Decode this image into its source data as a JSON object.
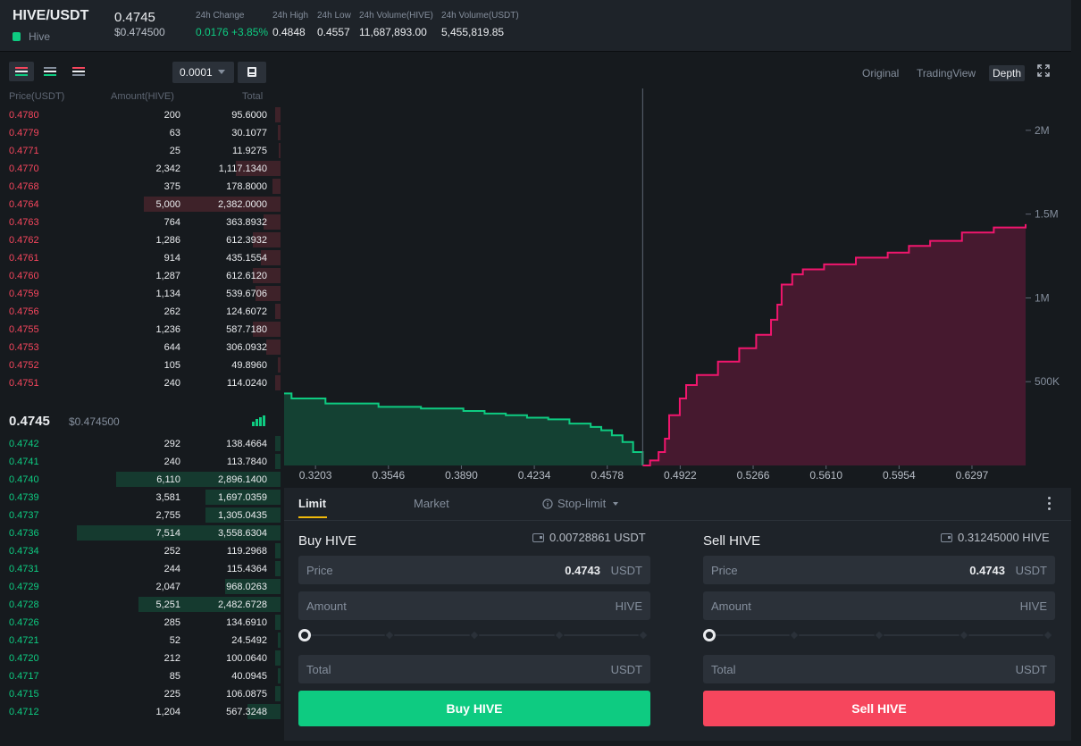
{
  "header": {
    "pair": "HIVE/USDT",
    "coin_name": "Hive",
    "last_price": "0.4745",
    "last_price_usd": "$0.474500",
    "stats": [
      {
        "label": "24h Change",
        "value": "0.0176 +3.85%"
      },
      {
        "label": "24h High",
        "value": "0.4848"
      },
      {
        "label": "24h Low",
        "value": "0.4557"
      },
      {
        "label": "24h Volume(HIVE)",
        "value": "11,687,893.00"
      },
      {
        "label": "24h Volume(USDT)",
        "value": "5,455,819.85"
      }
    ]
  },
  "orderbook": {
    "tick_size": "0.0001",
    "columns": [
      "Price(USDT)",
      "Amount(HIVE)",
      "Total"
    ],
    "asks": [
      {
        "price": "0.4780",
        "amount": "200",
        "total": "95.6000",
        "depth": 0.02
      },
      {
        "price": "0.4779",
        "amount": "63",
        "total": "30.1077",
        "depth": 0.01
      },
      {
        "price": "0.4771",
        "amount": "25",
        "total": "11.9275",
        "depth": 0.005
      },
      {
        "price": "0.4770",
        "amount": "2,342",
        "total": "1,117.1340",
        "depth": 0.16
      },
      {
        "price": "0.4768",
        "amount": "375",
        "total": "178.8000",
        "depth": 0.03
      },
      {
        "price": "0.4764",
        "amount": "5,000",
        "total": "2,382.0000",
        "depth": 0.49
      },
      {
        "price": "0.4763",
        "amount": "764",
        "total": "363.8932",
        "depth": 0.06
      },
      {
        "price": "0.4762",
        "amount": "1,286",
        "total": "612.3932",
        "depth": 0.1
      },
      {
        "price": "0.4761",
        "amount": "914",
        "total": "435.1554",
        "depth": 0.07
      },
      {
        "price": "0.4760",
        "amount": "1,287",
        "total": "612.6120",
        "depth": 0.1
      },
      {
        "price": "0.4759",
        "amount": "1,134",
        "total": "539.6706",
        "depth": 0.09
      },
      {
        "price": "0.4756",
        "amount": "262",
        "total": "124.6072",
        "depth": 0.02
      },
      {
        "price": "0.4755",
        "amount": "1,236",
        "total": "587.7180",
        "depth": 0.1
      },
      {
        "price": "0.4753",
        "amount": "644",
        "total": "306.0932",
        "depth": 0.05
      },
      {
        "price": "0.4752",
        "amount": "105",
        "total": "49.8960",
        "depth": 0.01
      },
      {
        "price": "0.4751",
        "amount": "240",
        "total": "114.0240",
        "depth": 0.02
      }
    ],
    "mid_price": "0.4745",
    "mid_price_usd": "$0.474500",
    "bids": [
      {
        "price": "0.4742",
        "amount": "292",
        "total": "138.4664",
        "depth": 0.02
      },
      {
        "price": "0.4741",
        "amount": "240",
        "total": "113.7840",
        "depth": 0.02
      },
      {
        "price": "0.4740",
        "amount": "6,110",
        "total": "2,896.1400",
        "depth": 0.59
      },
      {
        "price": "0.4739",
        "amount": "3,581",
        "total": "1,697.0359",
        "depth": 0.27
      },
      {
        "price": "0.4737",
        "amount": "2,755",
        "total": "1,305.0435",
        "depth": 0.27
      },
      {
        "price": "0.4736",
        "amount": "7,514",
        "total": "3,558.6304",
        "depth": 0.73
      },
      {
        "price": "0.4734",
        "amount": "252",
        "total": "119.2968",
        "depth": 0.02
      },
      {
        "price": "0.4731",
        "amount": "244",
        "total": "115.4364",
        "depth": 0.02
      },
      {
        "price": "0.4729",
        "amount": "2,047",
        "total": "968.0263",
        "depth": 0.2
      },
      {
        "price": "0.4728",
        "amount": "5,251",
        "total": "2,482.6728",
        "depth": 0.51
      },
      {
        "price": "0.4726",
        "amount": "285",
        "total": "134.6910",
        "depth": 0.02
      },
      {
        "price": "0.4721",
        "amount": "52",
        "total": "24.5492",
        "depth": 0.01
      },
      {
        "price": "0.4720",
        "amount": "212",
        "total": "100.0640",
        "depth": 0.02
      },
      {
        "price": "0.4717",
        "amount": "85",
        "total": "40.0945",
        "depth": 0.01
      },
      {
        "price": "0.4715",
        "amount": "225",
        "total": "106.0875",
        "depth": 0.02
      },
      {
        "price": "0.4712",
        "amount": "1,204",
        "total": "567.3248",
        "depth": 0.12
      }
    ]
  },
  "chart": {
    "views": [
      "Original",
      "TradingView",
      "Depth"
    ],
    "active_view": "Depth"
  },
  "chart_data": {
    "type": "area",
    "x_ticks": [
      "0.3203",
      "0.3546",
      "0.3890",
      "0.4234",
      "0.4578",
      "0.4922",
      "0.5266",
      "0.5610",
      "0.5954",
      "0.6297"
    ],
    "y_ticks": [
      "500K",
      "1M",
      "1.5M",
      "2M"
    ],
    "mid": 0.4745,
    "series": [
      {
        "color": "#0ecb81",
        "points": [
          [
            0.3055,
            430000
          ],
          [
            0.309,
            400000
          ],
          [
            0.325,
            370000
          ],
          [
            0.35,
            350000
          ],
          [
            0.37,
            340000
          ],
          [
            0.39,
            325000
          ],
          [
            0.4,
            310000
          ],
          [
            0.41,
            300000
          ],
          [
            0.42,
            285000
          ],
          [
            0.43,
            275000
          ],
          [
            0.44,
            250000
          ],
          [
            0.45,
            230000
          ],
          [
            0.455,
            210000
          ],
          [
            0.46,
            180000
          ],
          [
            0.465,
            140000
          ],
          [
            0.47,
            80000
          ],
          [
            0.4745,
            0
          ]
        ]
      },
      {
        "color": "#f0166d",
        "points": [
          [
            0.4745,
            0
          ],
          [
            0.478,
            30000
          ],
          [
            0.482,
            80000
          ],
          [
            0.485,
            160000
          ],
          [
            0.487,
            300000
          ],
          [
            0.492,
            400000
          ],
          [
            0.495,
            480000
          ],
          [
            0.5,
            540000
          ],
          [
            0.51,
            620000
          ],
          [
            0.52,
            700000
          ],
          [
            0.528,
            780000
          ],
          [
            0.535,
            870000
          ],
          [
            0.538,
            960000
          ],
          [
            0.54,
            1080000
          ],
          [
            0.545,
            1140000
          ],
          [
            0.55,
            1170000
          ],
          [
            0.56,
            1200000
          ],
          [
            0.575,
            1240000
          ],
          [
            0.59,
            1270000
          ],
          [
            0.6,
            1310000
          ],
          [
            0.61,
            1340000
          ],
          [
            0.625,
            1390000
          ],
          [
            0.64,
            1420000
          ],
          [
            0.655,
            1440000
          ]
        ]
      }
    ],
    "xlim": [
      0.3055,
      0.655
    ],
    "ylim": [
      0,
      2250000
    ]
  },
  "trade": {
    "tabs": [
      "Limit",
      "Market",
      "Stop-limit"
    ],
    "buy": {
      "title": "Buy HIVE",
      "available": "0.00728861 USDT",
      "price_label": "Price",
      "price_value": "0.4743",
      "price_unit": "USDT",
      "amount_label": "Amount",
      "amount_unit": "HIVE",
      "total_label": "Total",
      "total_unit": "USDT",
      "button": "Buy HIVE"
    },
    "sell": {
      "title": "Sell HIVE",
      "available": "0.31245000 HIVE",
      "price_label": "Price",
      "price_value": "0.4743",
      "price_unit": "USDT",
      "amount_label": "Amount",
      "amount_unit": "HIVE",
      "total_label": "Total",
      "total_unit": "USDT",
      "button": "Sell HIVE"
    }
  }
}
